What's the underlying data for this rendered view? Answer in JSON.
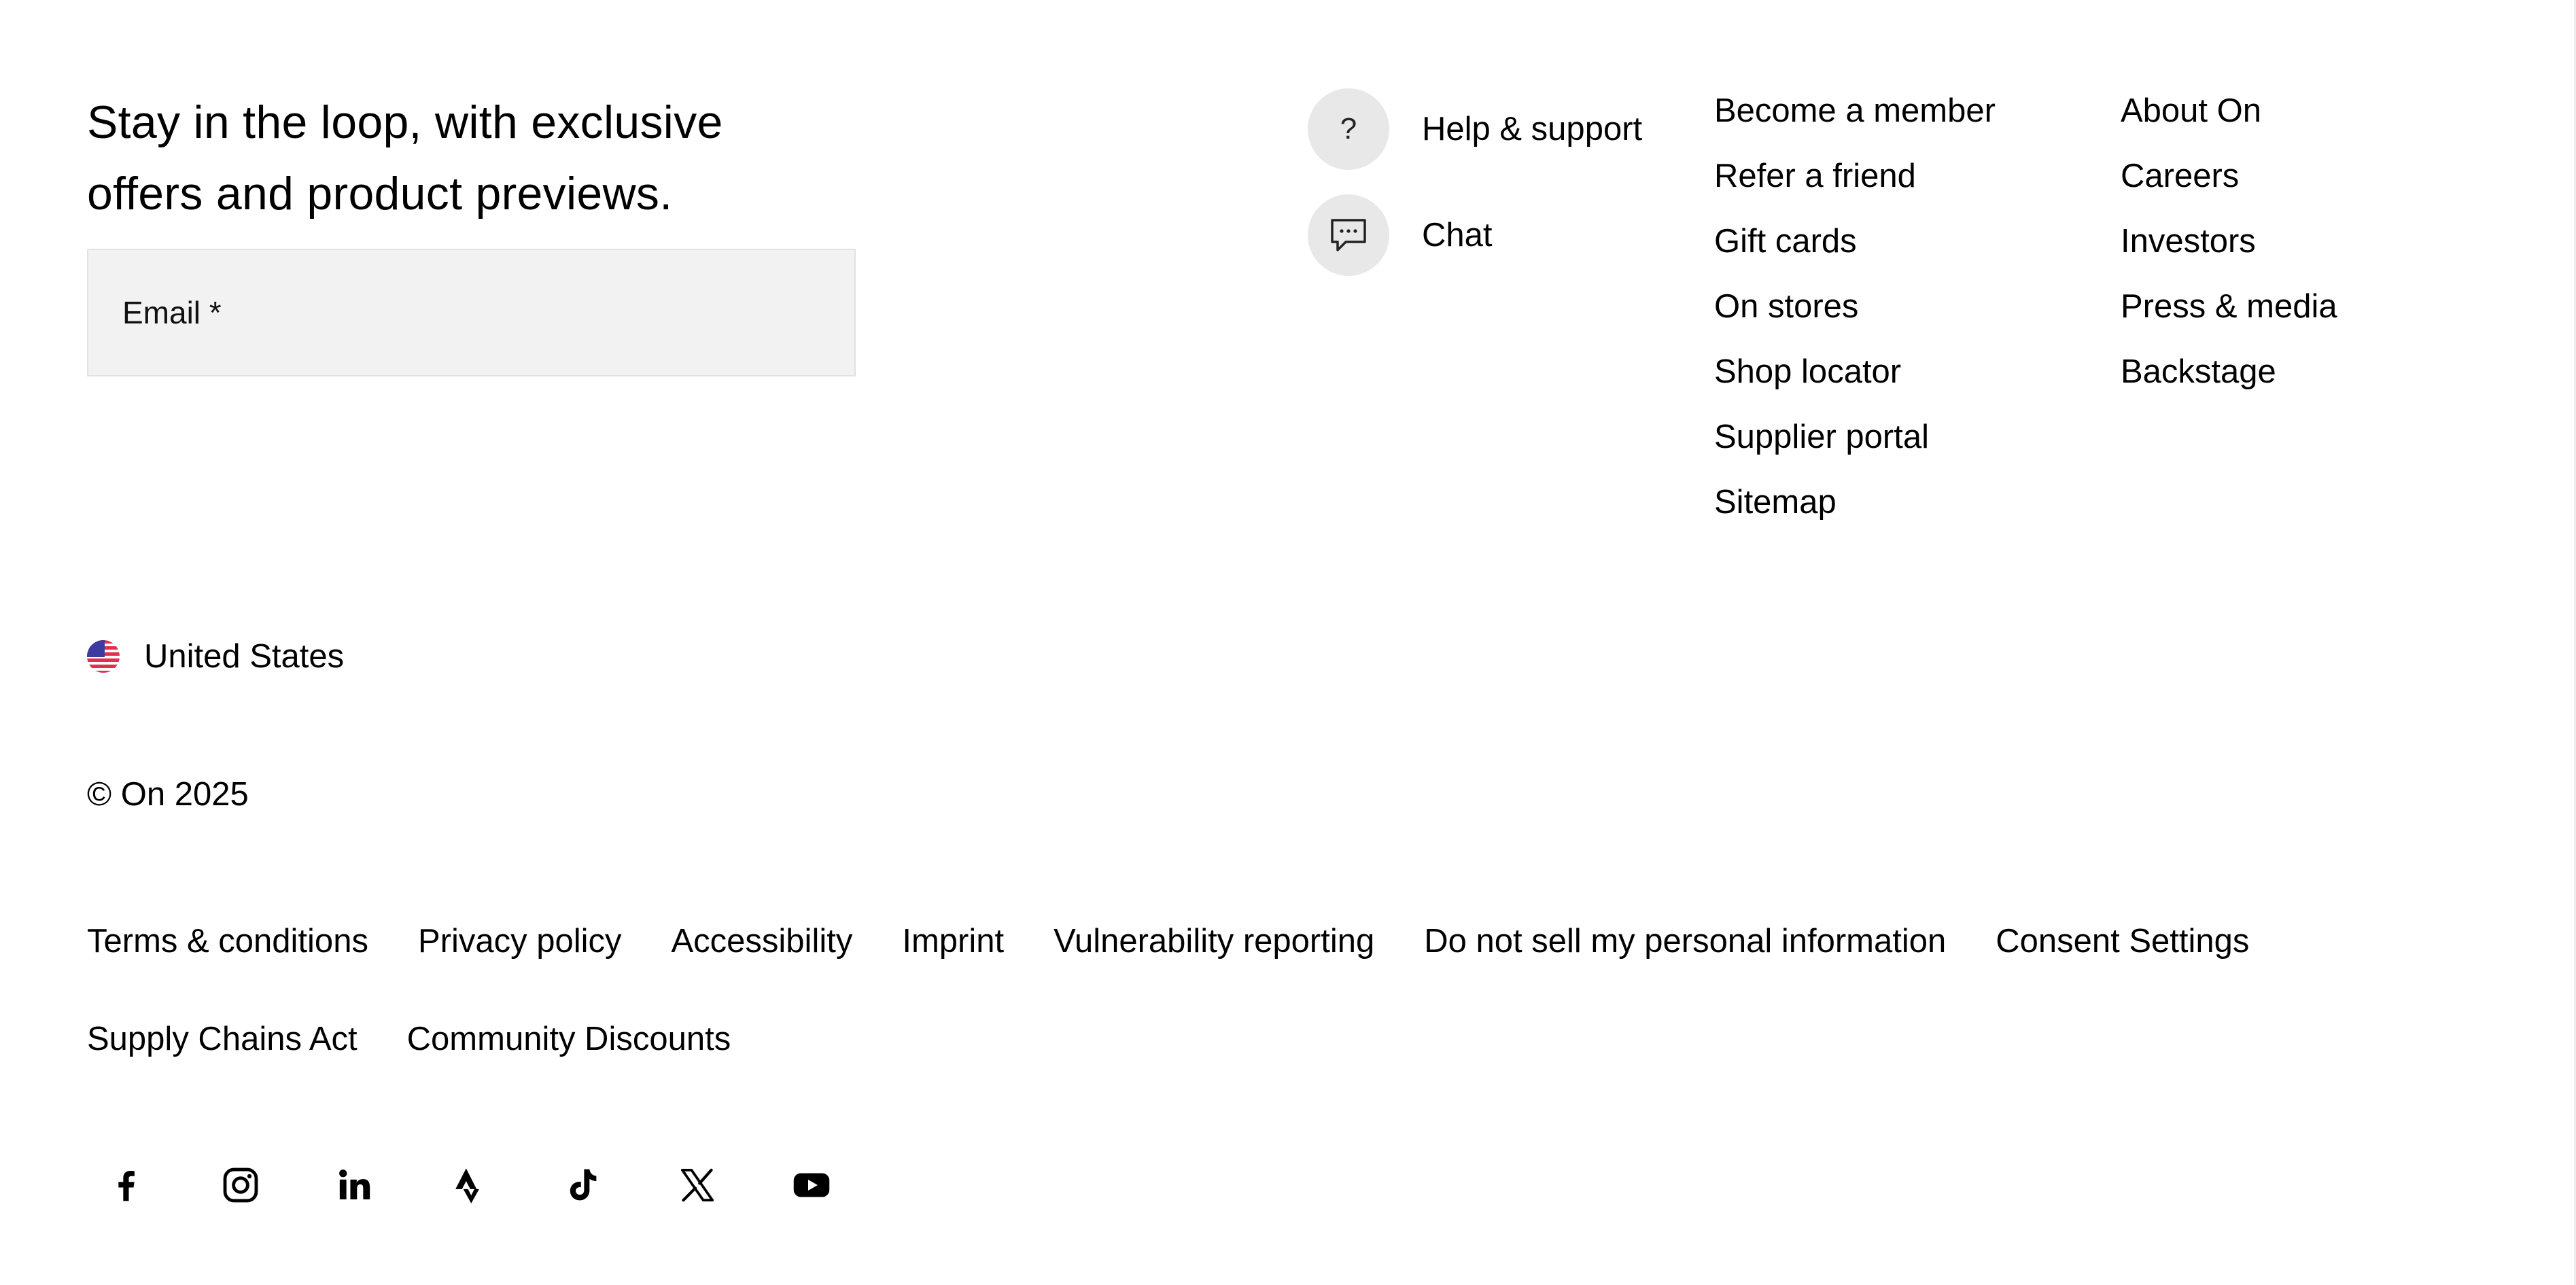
{
  "newsletter": {
    "heading": "Stay in the loop, with exclusive offers and product previews.",
    "email_label": "Email *",
    "email_value": ""
  },
  "support": [
    {
      "label": "Help & support",
      "icon": "question-icon",
      "glyph": "?"
    },
    {
      "label": "Chat",
      "icon": "chat-icon"
    }
  ],
  "links": {
    "column_1": [
      "Become a member",
      "Refer a friend",
      "Gift cards",
      "On stores",
      "Shop locator",
      "Supplier portal",
      "Sitemap"
    ],
    "column_2": [
      "About On",
      "Careers",
      "Investors",
      "Press & media",
      "Backstage"
    ]
  },
  "region": {
    "label": "United States",
    "icon": "us-flag-icon"
  },
  "copyright": "© On 2025",
  "legal_links": [
    "Terms & conditions",
    "Privacy policy",
    "Accessibility",
    "Imprint",
    "Vulnerability reporting",
    "Do not sell my personal information",
    "Consent Settings",
    "Supply Chains Act",
    "Community Discounts"
  ],
  "social": [
    "facebook-icon",
    "instagram-icon",
    "linkedin-icon",
    "strava-icon",
    "tiktok-icon",
    "x-icon",
    "youtube-icon"
  ],
  "colors": {
    "background": "#ffffff",
    "text": "#000000",
    "input_background": "#f2f2f2",
    "icon_circle": "#e8e8e8"
  }
}
